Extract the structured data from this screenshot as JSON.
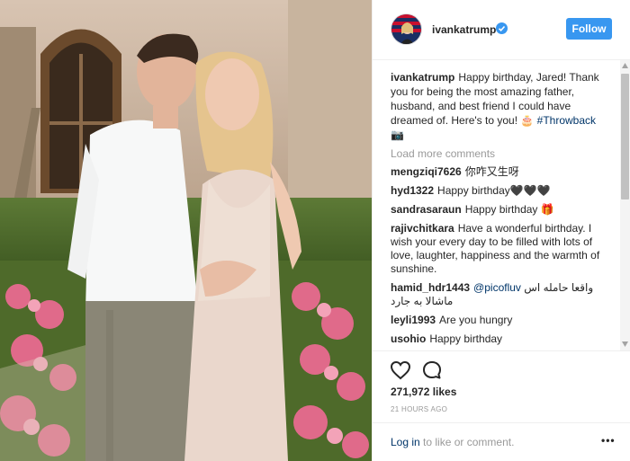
{
  "post": {
    "username": "ivankatrump",
    "follow_label": "Follow",
    "caption_user": "ivankatrump",
    "caption_text": "Happy birthday, Jared! Thank you for being the most amazing father, husband, and best friend I could have dreamed of. Here's to you! 🎂",
    "caption_hashtag": "#Throwback",
    "caption_camera": "📷",
    "load_more": "Load more comments",
    "comments": [
      {
        "user": "mengziqi7626",
        "text": "你咋又生呀"
      },
      {
        "user": "hyd1322",
        "text": "Happy birthday🖤🖤🖤"
      },
      {
        "user": "sandrasaraun",
        "text": "Happy birthday 🎁"
      },
      {
        "user": "rajivchitkara",
        "text": "Have a wonderful birthday. I wish your every day to be filled with lots of love, laughter, happiness and the warmth of sunshine."
      },
      {
        "user": "hamid_hdr1443",
        "mention": "@picofluv",
        "text": "واقعا حامله اس ماشالا به جارد"
      },
      {
        "user": "leyli1993",
        "text": "Are you hungry"
      },
      {
        "user": "usohio",
        "text": "Happy birthday"
      }
    ],
    "likes": "271,972 likes",
    "time_ago": "21 HOURS AGO",
    "login_link": "Log in",
    "login_suffix": " to like or comment.",
    "more_label": "•••"
  },
  "colors": {
    "accent": "#3897f0",
    "text": "#262626",
    "muted": "#999999",
    "link": "#003569"
  },
  "icons": [
    "verified-badge-icon",
    "heart-icon",
    "comment-icon",
    "more-options-icon"
  ]
}
